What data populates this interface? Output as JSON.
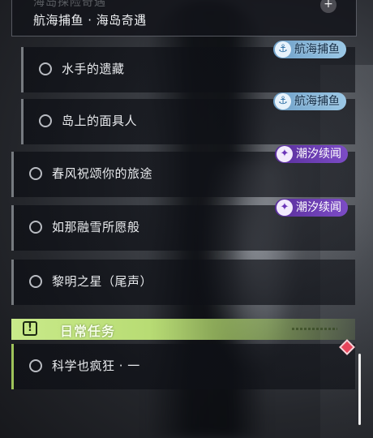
{
  "header": {
    "faded_text": "海岛探险奇遇",
    "title": "航海捕鱼 · 海岛奇遇",
    "plus_glyph": "+"
  },
  "quests": [
    {
      "label": "水手的遗藏",
      "tag": "航海捕鱼",
      "tag_type": "fish"
    },
    {
      "label": "岛上的面具人",
      "tag": "航海捕鱼",
      "tag_type": "fish"
    },
    {
      "label": "春风祝颂你的旅途",
      "tag": "潮汐续闻",
      "tag_type": "tide"
    },
    {
      "label": "如那融雪所愿般",
      "tag": "潮汐续闻",
      "tag_type": "tide"
    },
    {
      "label": "黎明之星（尾声）"
    }
  ],
  "daily": {
    "title": "日常任务",
    "icon_glyph": "!",
    "items": [
      {
        "label": "科学也疯狂 · 一"
      }
    ]
  },
  "icons": {
    "fish_tag": "anchor-icon",
    "tide_tag": "sparkle-icon",
    "daily": "warning-icon"
  },
  "tag_icon_glyphs": {
    "fish": "⚓",
    "tide": "✦"
  },
  "colors": {
    "daily_accent": "#c9ea8a",
    "fish_tag": "#9bc8e6",
    "tide_tag": "#7c4cc6",
    "alert": "#e8455c"
  }
}
